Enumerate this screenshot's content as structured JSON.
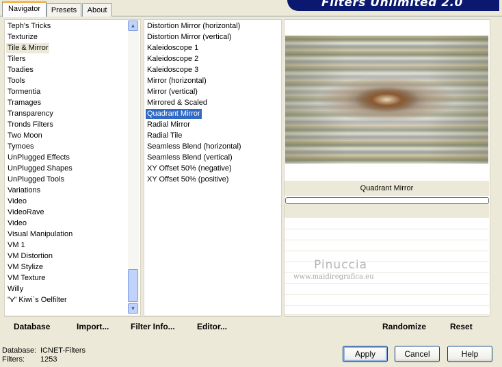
{
  "tabs": [
    "Navigator",
    "Presets",
    "About"
  ],
  "banner": "Filters Unlimited 2.0",
  "categories": [
    "Teph's Tricks",
    "Texturize",
    "Tile & Mirror",
    "Tilers",
    "Toadies",
    "Tools",
    "Tormentia",
    "Tramages",
    "Transparency",
    "Tronds Filters",
    "Two Moon",
    "Tymoes",
    "UnPlugged Effects",
    "UnPlugged Shapes",
    "UnPlugged Tools",
    "Variations",
    "Video",
    "VideoRave",
    "Video",
    "Visual Manipulation",
    "VM 1",
    "VM Distortion",
    "VM Stylize",
    "VM Texture",
    "Willy",
    "\"v\" Kiwi`s Oelfilter"
  ],
  "selected_category": "Tile & Mirror",
  "filters": [
    "Distortion Mirror (horizontal)",
    "Distortion Mirror (vertical)",
    "Kaleidoscope 1",
    "Kaleidoscope 2",
    "Kaleidoscope 3",
    "Mirror (horizontal)",
    "Mirror (vertical)",
    "Mirrored & Scaled",
    "Quadrant Mirror",
    "Radial Mirror",
    "Radial Tile",
    "Seamless Blend (horizontal)",
    "Seamless Blend (vertical)",
    "XY Offset 50% (negative)",
    "XY Offset 50% (positive)"
  ],
  "selected_filter": "Quadrant Mirror",
  "preview_caption": "Quadrant Mirror",
  "watermark": {
    "name": "Pinuccia",
    "site": "www.maidiregrafica.eu"
  },
  "toolbar": {
    "database": "Database",
    "import": "Import...",
    "filter_info": "Filter Info...",
    "editor": "Editor...",
    "randomize": "Randomize",
    "reset": "Reset"
  },
  "status": {
    "database_label": "Database:",
    "database_value": "ICNET-Filters",
    "filters_label": "Filters:",
    "filters_value": "1253"
  },
  "buttons": {
    "apply": "Apply",
    "cancel": "Cancel",
    "help": "Help"
  },
  "colors": {
    "selection": "#316ac5",
    "banner": "#0a1870",
    "tab_highlight": "#f5a623"
  }
}
